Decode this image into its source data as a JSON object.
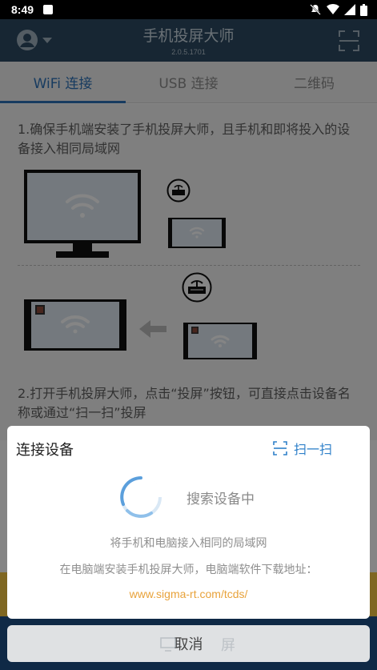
{
  "status_bar": {
    "time": "8:49"
  },
  "header": {
    "title": "手机投屏大师",
    "version": "2.0.5.1701",
    "avatar_icon": "user-avatar-icon",
    "scan_icon": "scan-frame-icon"
  },
  "tabs": [
    {
      "label": "WiFi 连接",
      "active": true
    },
    {
      "label": "USB 连接",
      "active": false
    },
    {
      "label": "二维码",
      "active": false
    }
  ],
  "content": {
    "step1": "1.确保手机端安装了手机投屏大师，且手机和即将投入的设备接入相同局域网",
    "step2": "2.打开手机投屏大师，点击“投屏”按钮，可直接点击设备名称或通过“扫一扫”投屏"
  },
  "dialog": {
    "title": "连接设备",
    "scan_label": "扫一扫",
    "searching": "搜索设备中",
    "hint_line1": "将手机和电脑接入相同的局域网",
    "hint_line2": "在电脑端安装手机投屏大师，电脑端软件下载地址：",
    "download_url": "www.sigma-rt.com/tcds/",
    "cancel_label": "取消",
    "ghost_label": "屏"
  },
  "colors": {
    "header_bg": "#2c4a63",
    "tab_active": "#2d72b8",
    "link": "#e8a23a",
    "scan_blue": "#2f80c9"
  }
}
